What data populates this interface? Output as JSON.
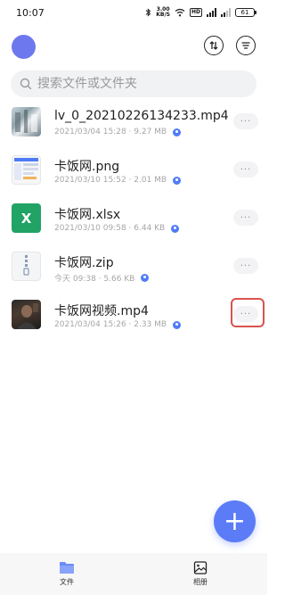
{
  "status_bar": {
    "time": "10:07",
    "net_speed_value": "3.00",
    "net_speed_unit": "KB/S",
    "hd_label": "HD",
    "battery": "61"
  },
  "header": {
    "transfer_icon": "transfer-arrows-icon",
    "sort_icon": "sort-lines-icon"
  },
  "search": {
    "placeholder": "搜索文件或文件夹"
  },
  "files": [
    {
      "name": "lv_0_20210226134233.mp4",
      "meta": "2021/03/04 15:28 · 9.27 MB",
      "thumb": "video-thumbnail"
    },
    {
      "name": "卡饭网.png",
      "meta": "2021/03/10 15:52 · 2.01 MB",
      "thumb": "image-thumbnail"
    },
    {
      "name": "卡饭网.xlsx",
      "meta": "2021/03/10 09:58 · 6.44 KB",
      "thumb": "excel-icon",
      "thumb_letter": "X"
    },
    {
      "name": "卡饭网.zip",
      "meta": "今天 09:38 · 5.66 KB",
      "thumb": "zip-icon"
    },
    {
      "name": "卡饭网视频.mp4",
      "meta": "2021/03/04 15:26 · 2.33 MB",
      "thumb": "video-thumbnail"
    }
  ],
  "more_label": "···",
  "fab_label": "+",
  "nav": {
    "files_label": "文件",
    "album_label": "相册"
  },
  "colors": {
    "accent": "#5b7cf6",
    "avatar": "#6e78ee",
    "highlight": "#d9544f",
    "excel_green": "#21a366"
  }
}
